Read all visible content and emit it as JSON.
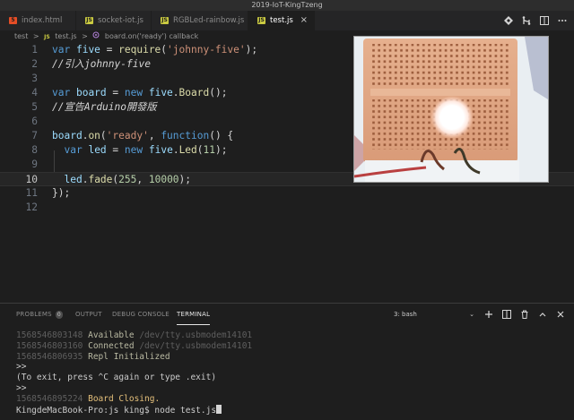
{
  "window": {
    "title": "2019-IoT-KingTzeng"
  },
  "tabs": [
    {
      "label": "index.html",
      "type": "html",
      "active": false
    },
    {
      "label": "socket-iot.js",
      "type": "js",
      "active": false
    },
    {
      "label": "RGBLed-rainbow.js",
      "type": "js",
      "active": false
    },
    {
      "label": "test.js",
      "type": "js",
      "active": true,
      "close": "×"
    }
  ],
  "breadcrumb": {
    "folder": "test",
    "sep1": ">",
    "file": "test.js",
    "sep2": ">",
    "symbol": "board.on('ready') callback"
  },
  "editor": {
    "lines": [
      {
        "n": "1"
      },
      {
        "n": "2"
      },
      {
        "n": "3"
      },
      {
        "n": "4"
      },
      {
        "n": "5"
      },
      {
        "n": "6"
      },
      {
        "n": "7"
      },
      {
        "n": "8"
      },
      {
        "n": "9"
      },
      {
        "n": "10"
      },
      {
        "n": "11"
      },
      {
        "n": "12"
      }
    ],
    "code": {
      "l1_kw": "var",
      "l1_var": "five",
      "l1_eq": " = ",
      "l1_fn": "require",
      "l1_str": "'johnny-five'",
      "l1_end": ");",
      "l2_cmt": "//引入johnny-five",
      "l4_kw": "var",
      "l4_var": "board",
      "l4_eq": " = ",
      "l4_new": "new",
      "l4_obj": "five",
      "l4_cls": "Board",
      "l4_end": "();",
      "l5_cmt": "//宣告Arduino開發版",
      "l7_obj": "board",
      "l7_fn": "on",
      "l7_str": "'ready'",
      "l7_kw": "function",
      "l7_end": "() {",
      "l8_kw": "var",
      "l8_var": "led",
      "l8_eq": " = ",
      "l8_new": "new",
      "l8_obj": "five",
      "l8_cls": "Led",
      "l8_num": "11",
      "l8_end": ");",
      "l10_obj": "led",
      "l10_fn": "fade",
      "l10_num1": "255",
      "l10_num2": "10000",
      "l10_end": ");",
      "l11": "});"
    }
  },
  "panel": {
    "tabs": [
      {
        "label": "PROBLEMS",
        "badge": "0"
      },
      {
        "label": "OUTPUT"
      },
      {
        "label": "DEBUG CONSOLE"
      },
      {
        "label": "TERMINAL",
        "active": true
      }
    ],
    "terminal_select": "3: bash"
  },
  "terminal": {
    "l1_ts": "1568546803148",
    "l1_msg": "Available",
    "l1_path": "/dev/tty.usbmodem14101",
    "l2_ts": "1568546803160",
    "l2_msg": "Connected",
    "l2_path": "/dev/tty.usbmodem14101",
    "l3_ts": "1568546806935",
    "l3_msg": "Repl Initialized",
    "l4": ">>",
    "l5": "(To exit, press ^C again or type .exit)",
    "l6": ">>",
    "l7_ts": "1568546895224",
    "l7_msg": "Board Closing.",
    "l8": "KingdeMacBook-Pro:js king$ node test.js"
  }
}
